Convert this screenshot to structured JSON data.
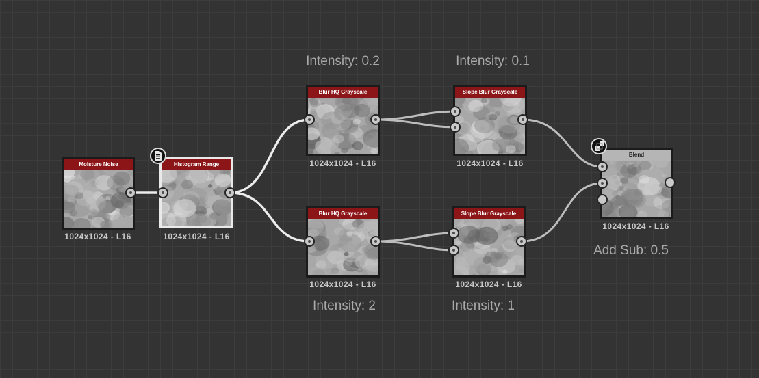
{
  "graph": {
    "nodes": [
      {
        "id": "moisture-noise",
        "title": "Moisture Noise",
        "caption": "1024x1024 - L16",
        "seed": 1
      },
      {
        "id": "histogram-range",
        "title": "Histogram Range",
        "caption": "1024x1024 - L16",
        "seed": 2,
        "selected": true
      },
      {
        "id": "blur-hq-top",
        "title": "Blur HQ Grayscale",
        "caption": "1024x1024 - L16",
        "seed": 3
      },
      {
        "id": "slope-blur-top",
        "title": "Slope Blur Grayscale",
        "caption": "1024x1024 - L16",
        "seed": 4
      },
      {
        "id": "blur-hq-bottom",
        "title": "Blur HQ Grayscale",
        "caption": "1024x1024 - L16",
        "seed": 5
      },
      {
        "id": "slope-blur-bottom",
        "title": "Slope Blur Grayscale",
        "caption": "1024x1024 - L16",
        "seed": 6
      },
      {
        "id": "blend",
        "title": "Blend",
        "caption": "1024x1024 - L16",
        "seed": 7,
        "header_color": "grey"
      }
    ],
    "labels": {
      "blur_top": "Intensity: 0.2",
      "slope_top": "Intensity: 0.1",
      "blur_bottom": "Intensity: 2",
      "slope_bottom": "Intensity: 1",
      "blend": "Add Sub: 0.5"
    },
    "icons": {
      "histogram_badge": "document-icon",
      "blend_badge": "blend-mode-icon"
    },
    "colors": {
      "node_header": "#8c1518",
      "blend_header": "#b5b5b5",
      "canvas_bg": "#333333",
      "wire": "#ececec"
    }
  }
}
